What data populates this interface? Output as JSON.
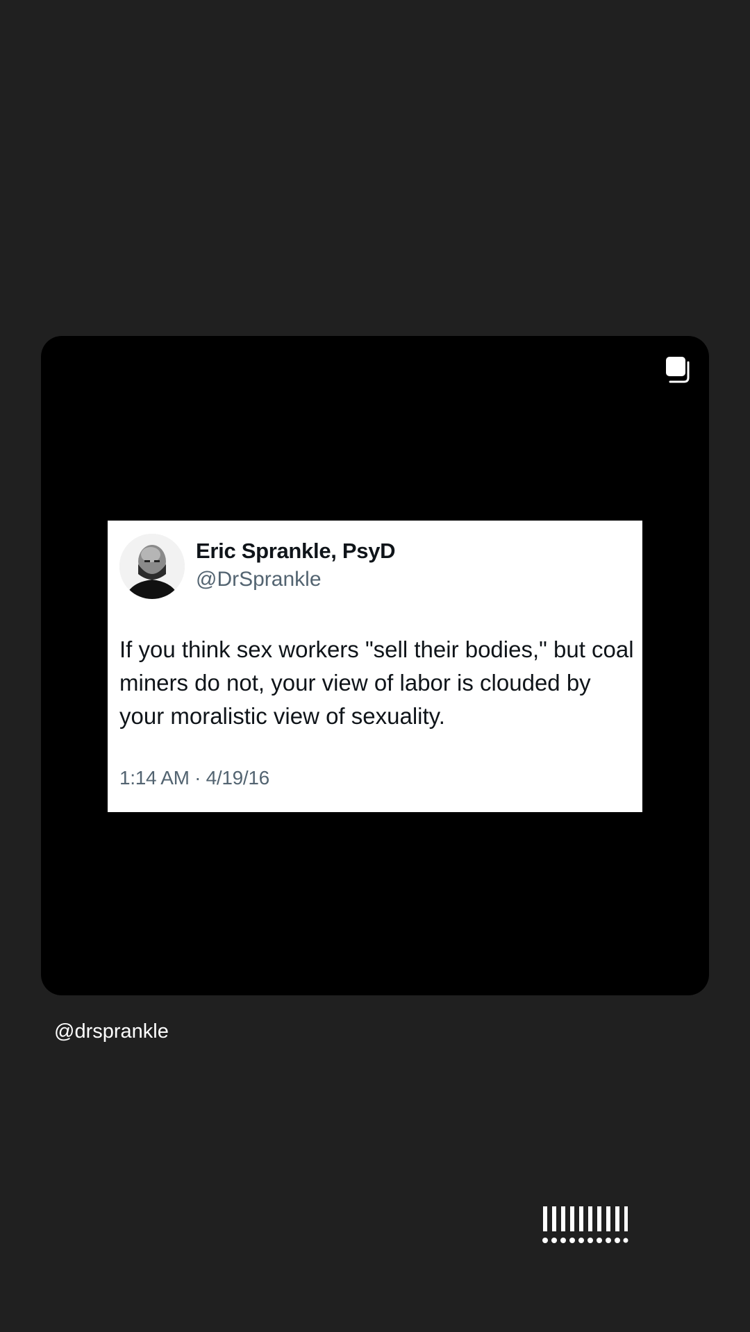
{
  "post": {
    "multi_image_icon": "carousel-stack-icon",
    "tweet": {
      "avatar_icon": "profile-photo",
      "author_name": "Eric Sprankle, PsyD",
      "author_handle": "@DrSprankle",
      "text": "If you think sex workers \"sell their bodies,\" but coal miners do not, your view of labor is clouded by your moralistic view of sexuality.",
      "timestamp": "1:14 AM · 4/19/16"
    }
  },
  "account": {
    "handle": "@drsprankle"
  },
  "badge": {
    "icon": "exclamation-dots-logo"
  },
  "colors": {
    "background": "#202020",
    "card": "#000000",
    "tweet_bg": "#ffffff",
    "tweet_text": "#0f1419",
    "tweet_muted": "#536471"
  }
}
